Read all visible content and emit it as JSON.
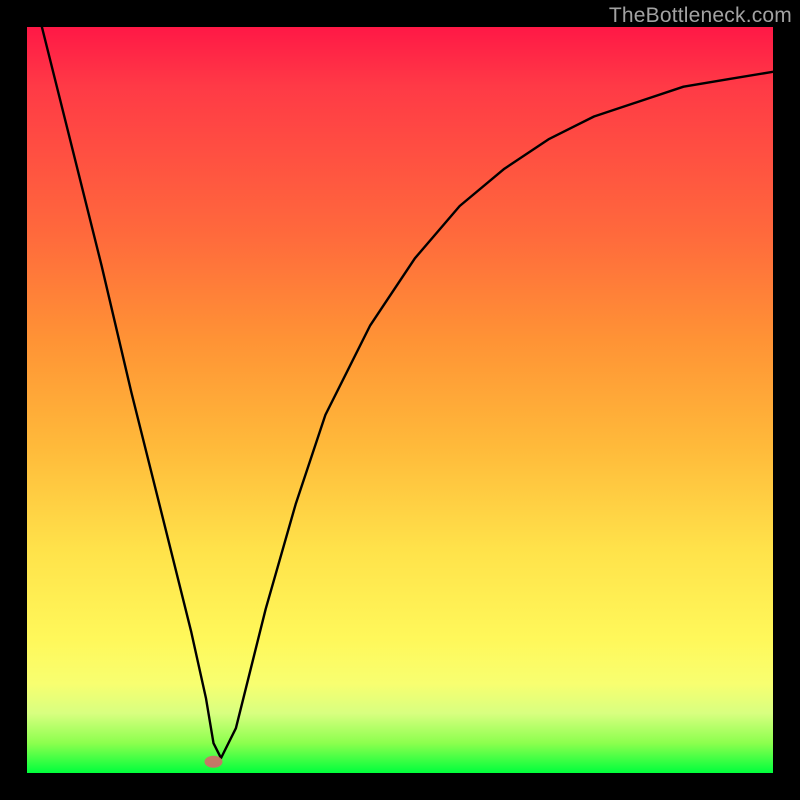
{
  "watermark": "TheBottleneck.com",
  "chart_data": {
    "type": "line",
    "title": "",
    "xlabel": "",
    "ylabel": "",
    "xlim": [
      0,
      100
    ],
    "ylim": [
      0,
      100
    ],
    "grid": false,
    "legend": false,
    "series": [
      {
        "name": "curve",
        "x": [
          2,
          6,
          10,
          14,
          18,
          22,
          24,
          25,
          26,
          28,
          32,
          36,
          40,
          46,
          52,
          58,
          64,
          70,
          76,
          82,
          88,
          94,
          100
        ],
        "y": [
          100,
          84,
          68,
          51,
          35,
          19,
          10,
          4,
          2,
          6,
          22,
          36,
          48,
          60,
          69,
          76,
          81,
          85,
          88,
          90,
          92,
          93,
          94
        ]
      }
    ],
    "markers": [
      {
        "name": "notch-marker",
        "x": 25,
        "y": 1.5,
        "color": "#d46a6a",
        "shape": "ellipse"
      }
    ],
    "background_gradient": {
      "direction": "vertical",
      "stops": [
        {
          "pos": 0.0,
          "color": "#ff1846"
        },
        {
          "pos": 0.28,
          "color": "#ff6a3c"
        },
        {
          "pos": 0.56,
          "color": "#ffb93a"
        },
        {
          "pos": 0.82,
          "color": "#fff85a"
        },
        {
          "pos": 0.96,
          "color": "#8cff4e"
        },
        {
          "pos": 1.0,
          "color": "#00ff3c"
        }
      ]
    }
  }
}
